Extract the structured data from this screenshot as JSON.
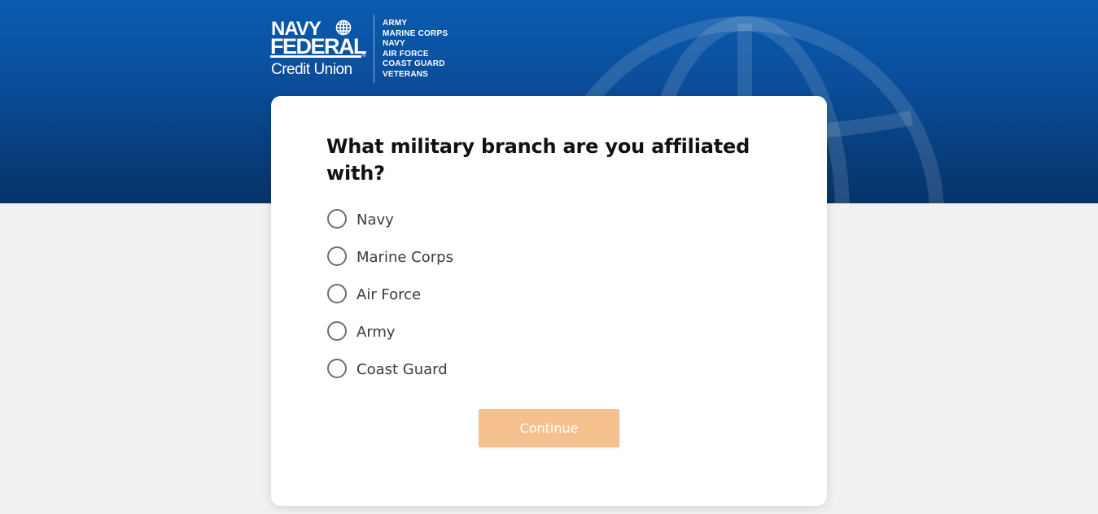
{
  "header": {
    "logo": {
      "line1": "NAVY",
      "line2": "FEDERAL",
      "line3": "Credit Union",
      "registered": "®"
    },
    "branches": [
      "ARMY",
      "MARINE CORPS",
      "NAVY",
      "AIR FORCE",
      "COAST GUARD",
      "VETERANS"
    ]
  },
  "form": {
    "question": "What military branch are you affiliated with?",
    "options": [
      {
        "label": "Navy",
        "selected": false
      },
      {
        "label": "Marine Corps",
        "selected": false
      },
      {
        "label": "Air Force",
        "selected": false
      },
      {
        "label": "Army",
        "selected": false
      },
      {
        "label": "Coast Guard",
        "selected": false
      }
    ],
    "continue_label": "Continue",
    "continue_disabled": true
  },
  "colors": {
    "brand_blue": "#0a4c98",
    "button_disabled": "#f6c18f",
    "background": "#f2f1ef"
  },
  "icons": [
    "globe-icon",
    "radio-unchecked-icon"
  ]
}
